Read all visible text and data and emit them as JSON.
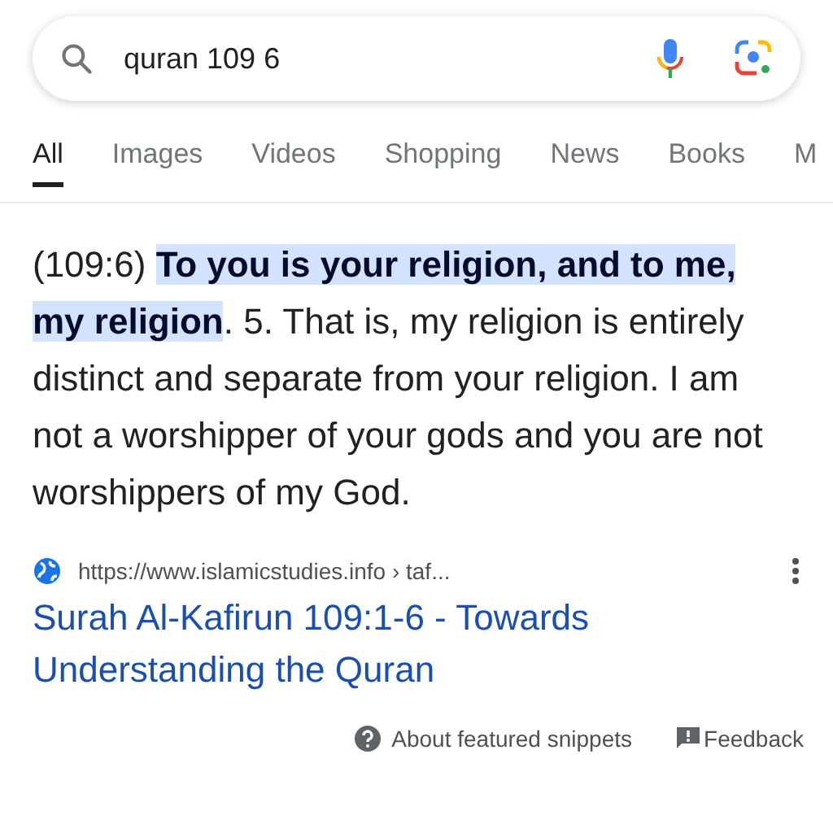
{
  "search": {
    "value": "quran 109 6"
  },
  "tabs": [
    {
      "label": "All",
      "selected": true
    },
    {
      "label": "Images",
      "selected": false
    },
    {
      "label": "Videos",
      "selected": false
    },
    {
      "label": "Shopping",
      "selected": false
    },
    {
      "label": "News",
      "selected": false
    },
    {
      "label": "Books",
      "selected": false
    },
    {
      "label": "M",
      "selected": false
    }
  ],
  "snippet": {
    "text": "(109:6) **To you is your religion, and to me, my religion**. 5. That is, my religion is entirely distinct and separate from your religion. I am not a worshipper of your gods and you are not worshippers of my God."
  },
  "result": {
    "url": "https://www.islamicstudies.info › taf...",
    "title": "Surah Al-Kafirun 109:1-6 - Towards Understanding the Quran"
  },
  "footer": {
    "about": "About featured snippets",
    "feedback": "Feedback"
  }
}
